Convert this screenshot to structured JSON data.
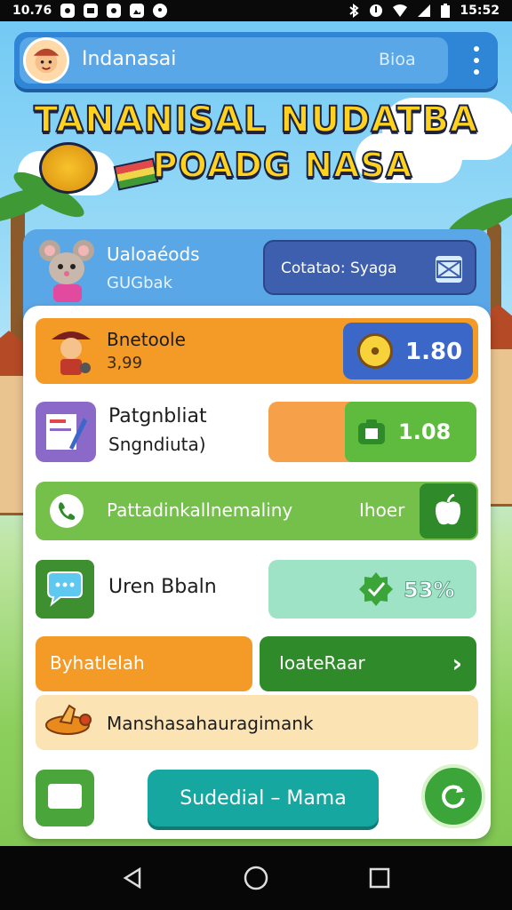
{
  "status_bar": {
    "time_left": "10.76",
    "time_right": "15:52"
  },
  "app_bar": {
    "title": "Indanasai",
    "badge": "Bioa"
  },
  "banner": {
    "line1": "TANANISAL NUDATBA",
    "line2": "POADG NASA"
  },
  "profile": {
    "name": "Ualoaéods",
    "subtitle": "GUGbak",
    "sync_button": "Cotatao: Syaga"
  },
  "rows": [
    {
      "label": "Bnetoole",
      "sublabel": "3,99",
      "value": "1.80"
    },
    {
      "label": "Patgnbliat",
      "sublabel": "Sngndiuta)",
      "value": "1.08"
    },
    {
      "label": "Pattadinkallnemaliny",
      "badge": "Ihoer"
    },
    {
      "label": "Uren Bbaln",
      "value": "53%"
    }
  ],
  "split_buttons": {
    "left_label": "Byhatlelah",
    "right_label": "IoateRaar"
  },
  "info_row": {
    "label": "Manshasahauragimank"
  },
  "cta": {
    "label": "Sudedial – Mama"
  },
  "colors": {
    "app_bar": "#2f86d6",
    "orange": "#f49a26",
    "blue_pill": "#3b67c9",
    "green": "#74c04a",
    "dark_green": "#2f8a2a",
    "teal": "#16a7a0",
    "mint": "#9fe3c6"
  },
  "icons": [
    "avatar-icon",
    "kebab-menu-icon",
    "mail-icon",
    "trophy-icon",
    "camera-icon",
    "phone-icon",
    "apple-icon",
    "chat-icon",
    "chevron-right-icon",
    "refresh-icon",
    "back-icon",
    "home-icon",
    "recents-icon"
  ]
}
